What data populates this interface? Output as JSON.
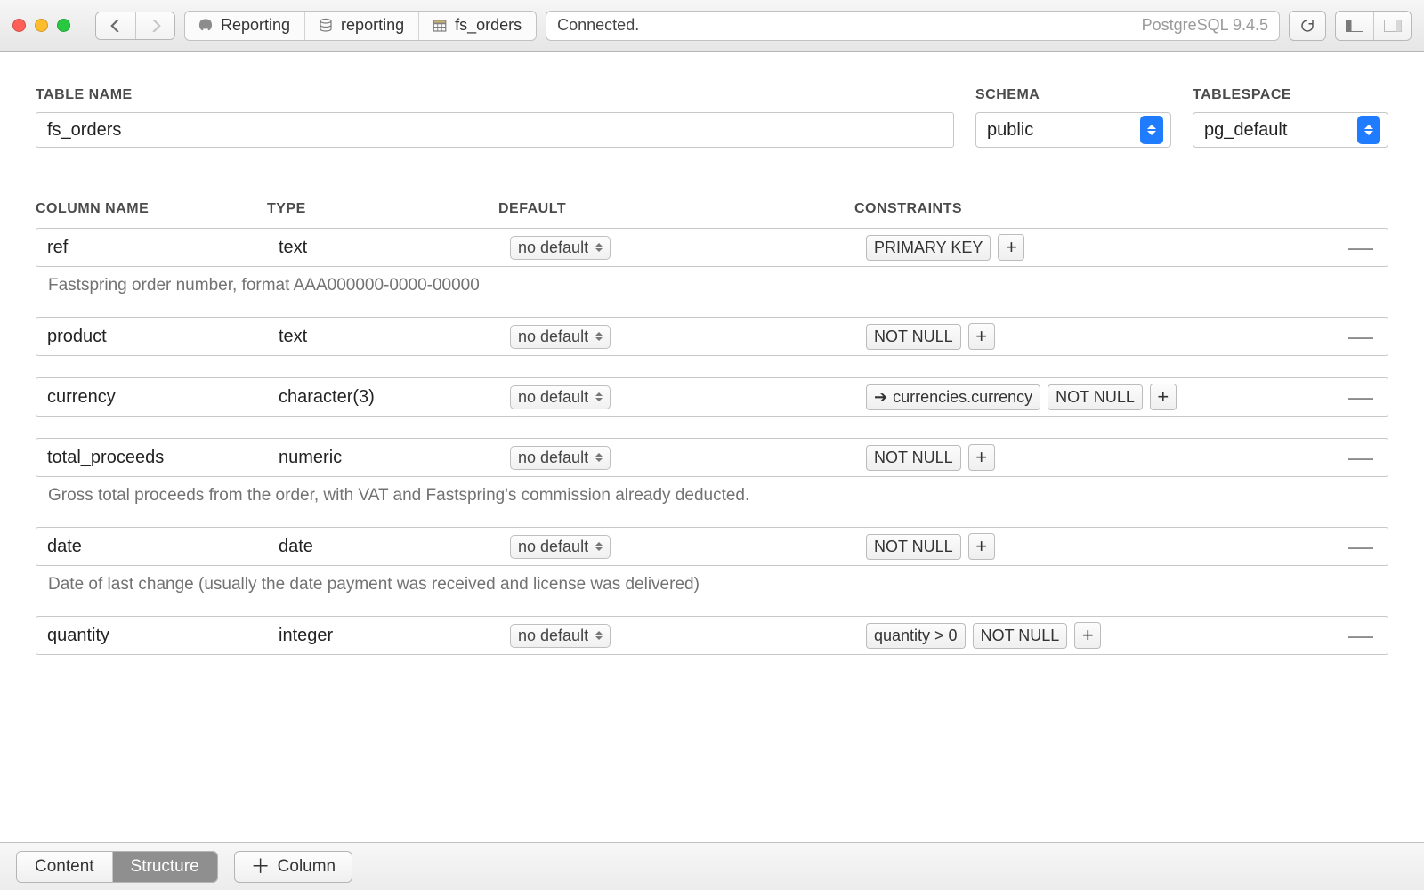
{
  "toolbar": {
    "breadcrumb": [
      {
        "icon": "elephant",
        "label": "Reporting"
      },
      {
        "icon": "database",
        "label": "reporting"
      },
      {
        "icon": "table",
        "label": "fs_orders"
      }
    ],
    "status": "Connected.",
    "db_version": "PostgreSQL 9.4.5"
  },
  "header": {
    "labels": {
      "table_name": "TABLE NAME",
      "schema": "SCHEMA",
      "tablespace": "TABLESPACE"
    },
    "table_name": "fs_orders",
    "schema": "public",
    "tablespace": "pg_default"
  },
  "column_headers": {
    "name": "COLUMN NAME",
    "type": "TYPE",
    "default": "DEFAULT",
    "constraints": "CONSTRAINTS"
  },
  "default_label": "no default",
  "columns": [
    {
      "name": "ref",
      "type": "text",
      "constraints": [
        {
          "kind": "pill",
          "label": "PRIMARY KEY"
        }
      ],
      "description": "Fastspring order number, format AAA000000-0000-00000"
    },
    {
      "name": "product",
      "type": "text",
      "constraints": [
        {
          "kind": "pill",
          "label": "NOT NULL"
        }
      ],
      "description": ""
    },
    {
      "name": "currency",
      "type": "character(3)",
      "constraints": [
        {
          "kind": "fk",
          "label": "currencies.currency"
        },
        {
          "kind": "pill",
          "label": "NOT NULL"
        }
      ],
      "description": ""
    },
    {
      "name": "total_proceeds",
      "type": "numeric",
      "constraints": [
        {
          "kind": "pill",
          "label": "NOT NULL"
        }
      ],
      "description": "Gross total proceeds from the order, with VAT and Fastspring's commission already deducted."
    },
    {
      "name": "date",
      "type": "date",
      "constraints": [
        {
          "kind": "pill",
          "label": "NOT NULL"
        }
      ],
      "description": "Date of last change (usually the date payment was received and license was delivered)"
    },
    {
      "name": "quantity",
      "type": "integer",
      "constraints": [
        {
          "kind": "pill",
          "label": "quantity > 0"
        },
        {
          "kind": "pill",
          "label": "NOT NULL"
        }
      ],
      "description": ""
    }
  ],
  "bottom": {
    "tabs": {
      "content": "Content",
      "structure": "Structure"
    },
    "active_tab": "structure",
    "add_column": "Column"
  }
}
